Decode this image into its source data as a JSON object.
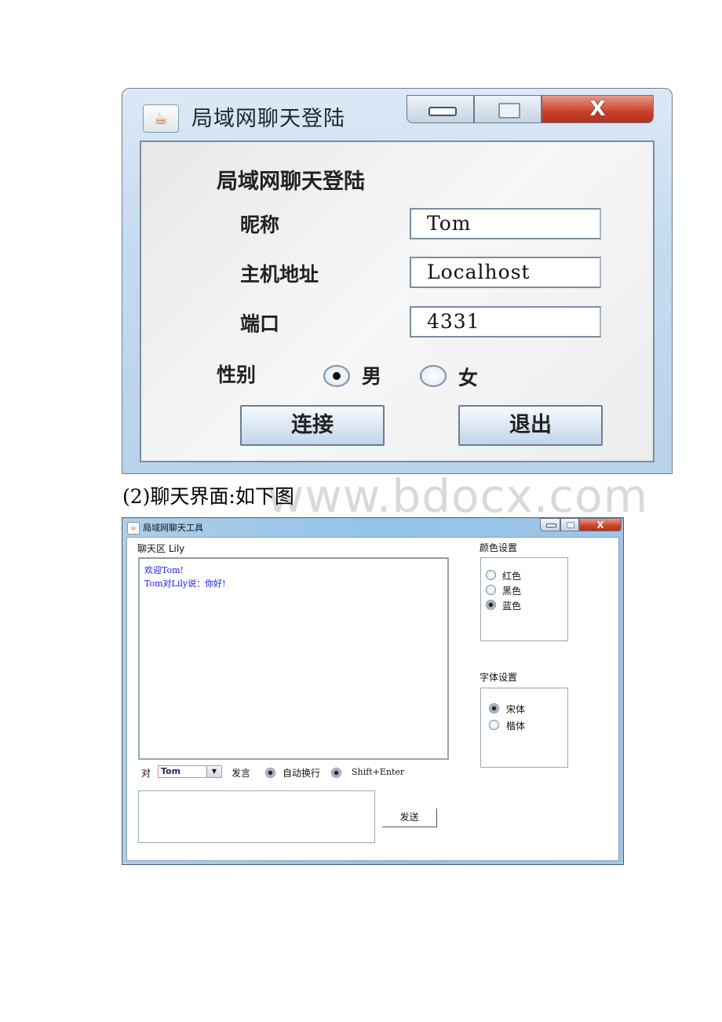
{
  "login_window": {
    "title": "局域网聊天登陆",
    "close_glyph": "X",
    "heading": "局域网聊天登陆",
    "fields": [
      {
        "label": "昵称",
        "value": "Tom"
      },
      {
        "label": "主机地址",
        "value": "Localhost"
      },
      {
        "label": "端口",
        "value": "4331"
      }
    ],
    "gender": {
      "label": "性别",
      "options": [
        {
          "label": "男",
          "selected": true
        },
        {
          "label": "女",
          "selected": false
        }
      ]
    },
    "buttons": {
      "connect": "连接",
      "exit": "退出"
    }
  },
  "caption": "(2)聊天界面:如下图",
  "watermark": "www.bdocx.com",
  "chat_window": {
    "title": "局域网聊天工具",
    "close_glyph": "X",
    "chat_area_label": "聊天区 Lily",
    "messages": [
      "欢迎Tom!",
      "Tom对Lily说：你好!"
    ],
    "message_color": "#1515e8",
    "to_label": "对",
    "recipient": "Tom",
    "speak_label": "发言",
    "options": [
      {
        "label": "自动换行",
        "selected": true
      },
      {
        "label": "Shift+Enter",
        "selected": true
      }
    ],
    "input_value": "",
    "send_label": "发送",
    "color_settings": {
      "label": "颜色设置",
      "options": [
        {
          "label": "红色",
          "selected": false
        },
        {
          "label": "黑色",
          "selected": false
        },
        {
          "label": "蓝色",
          "selected": true
        }
      ]
    },
    "font_settings": {
      "label": "字体设置",
      "options": [
        {
          "label": "宋体",
          "selected": true
        },
        {
          "label": "楷体",
          "selected": false
        }
      ]
    }
  }
}
